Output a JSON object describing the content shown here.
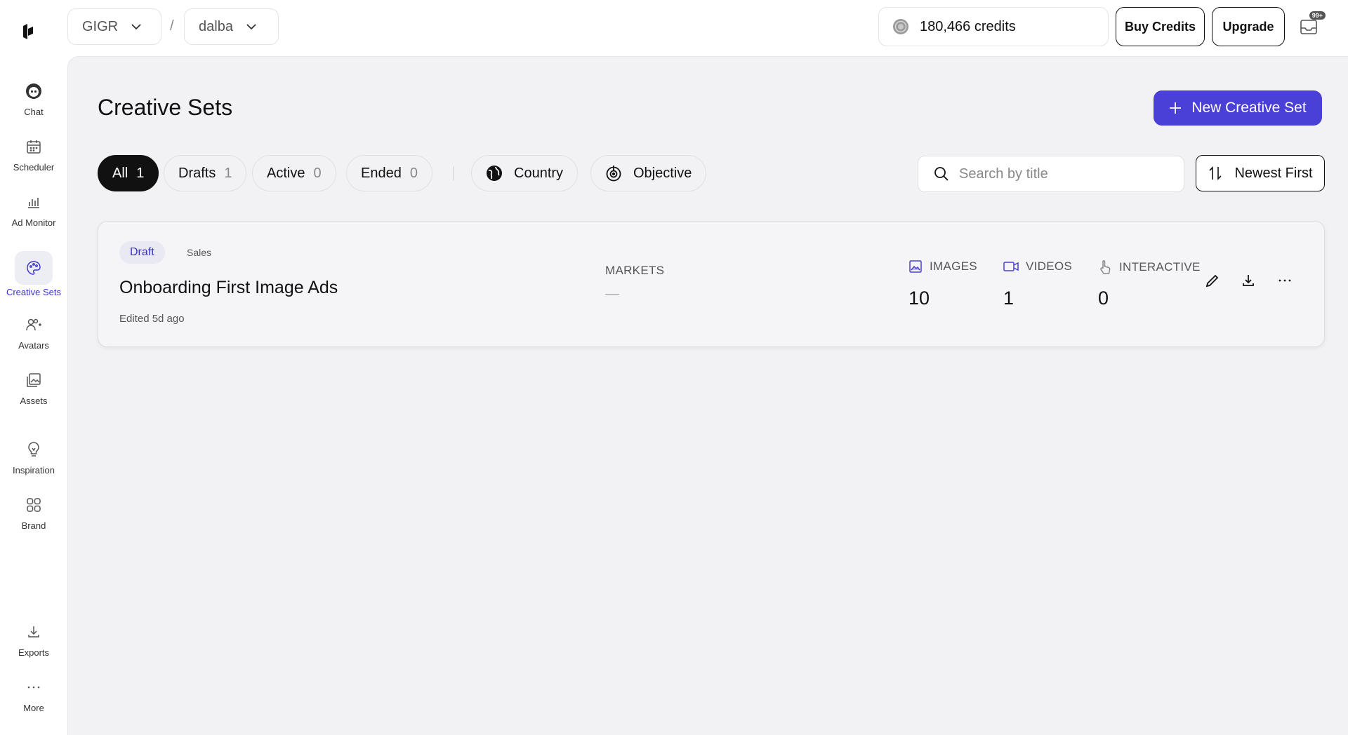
{
  "sidebar": {
    "items": [
      {
        "label": "Chat",
        "icon": "chat-bot-icon"
      },
      {
        "label": "Scheduler",
        "icon": "calendar-icon"
      },
      {
        "label": "Ad Monitor",
        "icon": "bar-chart-icon"
      },
      {
        "label": "Creative Sets",
        "icon": "palette-icon",
        "active": true
      },
      {
        "label": "Avatars",
        "icon": "users-add-icon"
      },
      {
        "label": "Assets",
        "icon": "image-stack-icon"
      },
      {
        "label": "Inspiration",
        "icon": "lightbulb-icon"
      },
      {
        "label": "Brand",
        "icon": "grid-icon"
      },
      {
        "label": "Exports",
        "icon": "download-icon"
      },
      {
        "label": "More",
        "icon": "more-dots-icon"
      }
    ]
  },
  "topbar": {
    "workspace": "GIGR",
    "separator": "/",
    "project": "dalba",
    "credits": "180,466 credits",
    "buy_credits": "Buy Credits",
    "upgrade": "Upgrade",
    "inbox_badge": "99+"
  },
  "page": {
    "title": "Creative Sets",
    "new_button": "New Creative Set"
  },
  "filters": {
    "tabs": [
      {
        "label": "All",
        "count": "1",
        "selected": true
      },
      {
        "label": "Drafts",
        "count": "1"
      },
      {
        "label": "Active",
        "count": "0"
      },
      {
        "label": "Ended",
        "count": "0"
      }
    ],
    "country": "Country",
    "objective": "Objective",
    "search_placeholder": "Search by title",
    "sort": "Newest First"
  },
  "card": {
    "status": "Draft",
    "category": "Sales",
    "title": "Onboarding First Image Ads",
    "edited": "Edited 5d ago",
    "markets_label": "MARKETS",
    "markets_value": "—",
    "images_label": "IMAGES",
    "images_value": "10",
    "videos_label": "VIDEOS",
    "videos_value": "1",
    "interactive_label": "INTERACTIVE",
    "interactive_value": "0"
  },
  "colors": {
    "accent": "#4a3fd6",
    "accent_text": "#3b32c4",
    "background": "#f2f2f4"
  }
}
